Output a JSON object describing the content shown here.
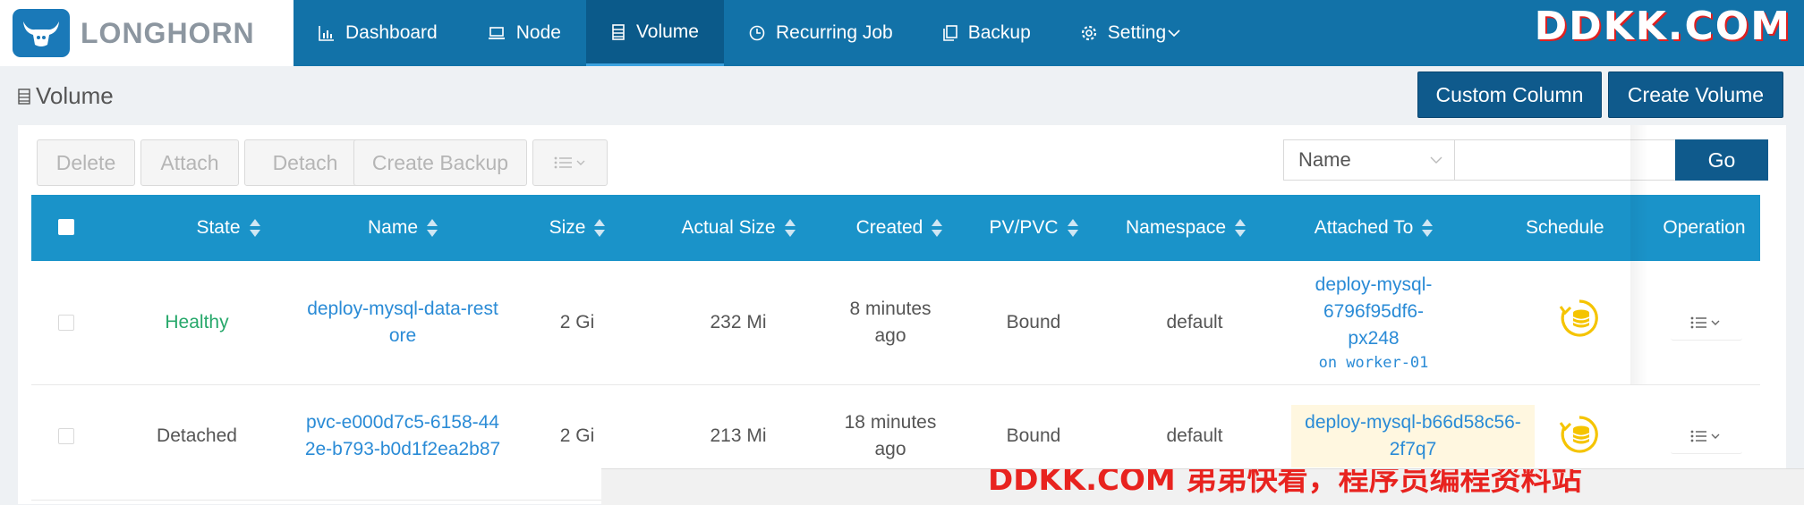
{
  "app": {
    "brand": "LONGHORN",
    "watermark": "DDKK.COM"
  },
  "nav": {
    "items": [
      {
        "label": "Dashboard",
        "icon": "bar-chart-icon"
      },
      {
        "label": "Node",
        "icon": "laptop-icon"
      },
      {
        "label": "Volume",
        "icon": "database-icon",
        "active": true
      },
      {
        "label": "Recurring Job",
        "icon": "clock-icon"
      },
      {
        "label": "Backup",
        "icon": "copy-icon"
      },
      {
        "label": "Setting",
        "icon": "gear-icon"
      }
    ]
  },
  "page": {
    "title": "Volume",
    "custom_column_label": "Custom Column",
    "create_volume_label": "Create Volume"
  },
  "toolbar": {
    "delete_label": "Delete",
    "attach_label": "Attach",
    "detach_label": "Detach",
    "create_backup_label": "Create Backup"
  },
  "search": {
    "field": "Name",
    "value": "",
    "go_label": "Go"
  },
  "table": {
    "headers": {
      "state": "State",
      "name": "Name",
      "size": "Size",
      "actual_size": "Actual Size",
      "created": "Created",
      "pvpvc": "PV/PVC",
      "namespace": "Namespace",
      "attached_to": "Attached To",
      "schedule": "Schedule",
      "operation": "Operation"
    },
    "rows": [
      {
        "state": "Healthy",
        "name_l1": "deploy-mysql-data-rest",
        "name_l2": "ore",
        "size": "2 Gi",
        "actual_size": "232 Mi",
        "created_l1": "8 minutes",
        "created_l2": "ago",
        "pvpvc": "Bound",
        "namespace": "default",
        "attached_l1": "deploy-mysql-6796f95df6-",
        "attached_l2": "px248",
        "attached_node": "on worker-01"
      },
      {
        "state": "Detached",
        "name_l1": "pvc-e000d7c5-6158-44",
        "name_l2": "2e-b793-b0d1f2ea2b87",
        "size": "2 Gi",
        "actual_size": "213 Mi",
        "created_l1": "18 minutes",
        "created_l2": "ago",
        "pvpvc": "Bound",
        "namespace": "default",
        "attached_l1": "deploy-mysql-b66d58c56-",
        "attached_l2": "2f7q7"
      }
    ]
  },
  "overlay": {
    "text": "DDKK.COM 弟弟快看，程序员编程资料站"
  },
  "colors": {
    "nav_bg": "#1272a8",
    "header_bg": "#1a93c9",
    "button_bg": "#0f5a8c",
    "healthy": "#27a86b",
    "link": "#2a8bd6",
    "schedule_icon": "#f5c400"
  }
}
